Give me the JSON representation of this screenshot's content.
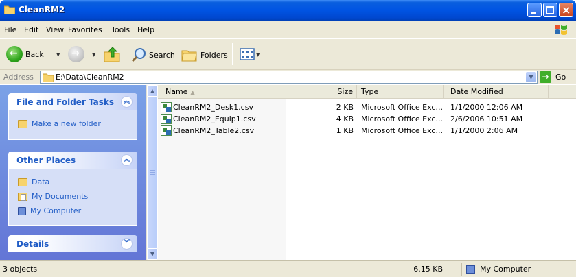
{
  "window": {
    "title": "CleanRM2"
  },
  "menu": [
    "File",
    "Edit",
    "View",
    "Favorites",
    "Tools",
    "Help"
  ],
  "toolbar": {
    "back_label": "Back",
    "search_label": "Search",
    "folders_label": "Folders"
  },
  "address": {
    "label": "Address",
    "value": "E:\\Data\\CleanRM2",
    "go_label": "Go"
  },
  "taskpane": {
    "file_tasks": {
      "title": "File and Folder Tasks",
      "items": [
        "Make a new folder"
      ]
    },
    "other_places": {
      "title": "Other Places",
      "items": [
        "Data",
        "My Documents",
        "My Computer"
      ]
    },
    "details": {
      "title": "Details"
    }
  },
  "filelist": {
    "columns": [
      "Name",
      "Size",
      "Type",
      "Date Modified"
    ],
    "rows": [
      {
        "name": "CleanRM2_Desk1.csv",
        "size": "2 KB",
        "type": "Microsoft Office Exc...",
        "modified": "1/1/2000 12:06 AM"
      },
      {
        "name": "CleanRM2_Equip1.csv",
        "size": "4 KB",
        "type": "Microsoft Office Exc...",
        "modified": "2/6/2006 10:51 AM"
      },
      {
        "name": "CleanRM2_Table2.csv",
        "size": "1 KB",
        "type": "Microsoft Office Exc...",
        "modified": "1/1/2000 2:06 AM"
      }
    ]
  },
  "status": {
    "count": "3 objects",
    "size": "6.15 KB",
    "location": "My Computer"
  }
}
